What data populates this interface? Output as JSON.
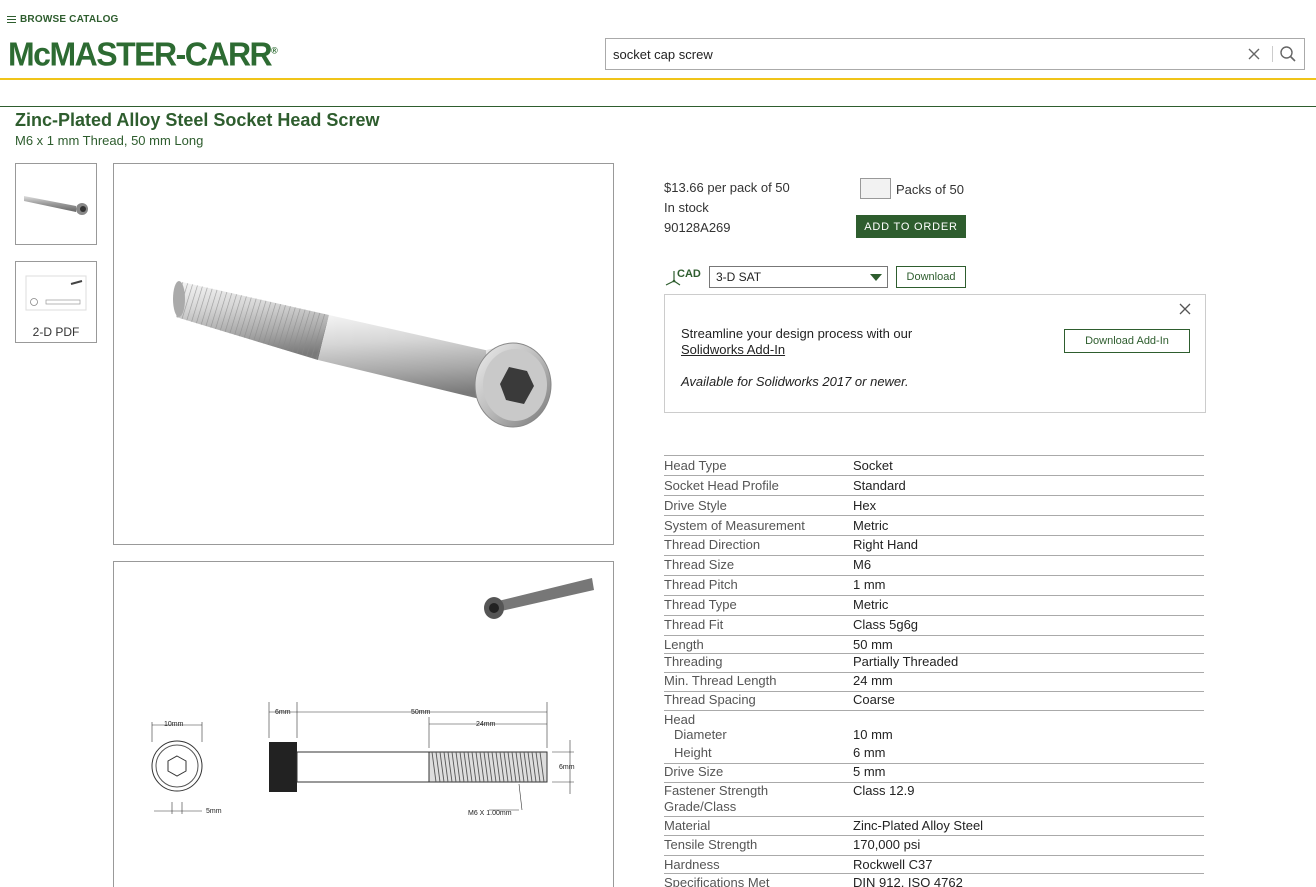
{
  "header": {
    "browse_label": "BROWSE CATALOG",
    "logo_text": "McMASTER-CARR",
    "logo_mark": "®",
    "search_value": "socket cap screw"
  },
  "product": {
    "title": "Zinc-Plated Alloy Steel Socket Head Screw",
    "subtitle": "M6 x 1 mm Thread, 50 mm Long",
    "pdf_label": "2-D PDF",
    "price": "$13.66 per pack of 50",
    "stock": "In stock",
    "part_number": "90128A269",
    "packs_label": "Packs of 50",
    "add_to_order": "ADD TO ORDER"
  },
  "cad": {
    "label": "CAD",
    "format_selected": "3-D SAT",
    "download": "Download"
  },
  "addin_panel": {
    "line1": "Streamline your design process with our",
    "link": "Solidworks Add-In",
    "availability": "Available for Solidworks 2017 or newer.",
    "button": "Download Add-In"
  },
  "drawing_labels": {
    "head_dia": "10mm",
    "head_height": "6mm",
    "length": "50mm",
    "thread_length": "24mm",
    "drive": "5mm",
    "dia": "6mm",
    "thread": "M6 X 1.00mm"
  },
  "specs": [
    {
      "k": "Head Type",
      "v": "Socket"
    },
    {
      "k": "Socket Head Profile",
      "v": "Standard"
    },
    {
      "k": "Drive Style",
      "v": "Hex"
    },
    {
      "k": "System of Measurement",
      "v": "Metric"
    },
    {
      "k": "Thread Direction",
      "v": "Right Hand"
    },
    {
      "k": "Thread Size",
      "v": "M6"
    },
    {
      "k": "Thread Pitch",
      "v": "1 mm"
    },
    {
      "k": "Thread Type",
      "v": "Metric"
    },
    {
      "k": "Thread Fit",
      "v": "Class 5g6g"
    },
    {
      "k": "Length",
      "v": "50 mm"
    },
    {
      "k": "Threading",
      "v": "Partially Threaded"
    },
    {
      "k": "Min. Thread Length",
      "v": "24 mm"
    },
    {
      "k": "Thread Spacing",
      "v": "Coarse"
    },
    {
      "k": "Head",
      "v": ""
    },
    {
      "k": "Diameter",
      "v": "10 mm"
    },
    {
      "k": "Height",
      "v": "6 mm"
    },
    {
      "k": "Drive Size",
      "v": "5 mm"
    },
    {
      "k": "Fastener Strength Grade/Class",
      "v": "Class 12.9"
    },
    {
      "k": "Material",
      "v": "Zinc-Plated Alloy Steel"
    },
    {
      "k": "Tensile Strength",
      "v": "170,000 psi"
    },
    {
      "k": "Hardness",
      "v": "Rockwell C37"
    },
    {
      "k": "Specifications Met",
      "v": "DIN 912, ISO 4762"
    }
  ]
}
